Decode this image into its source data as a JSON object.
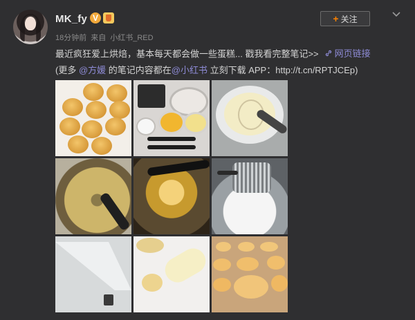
{
  "post": {
    "username": "MK_fy",
    "verified_badge": "V",
    "meta_time": "18分钟前",
    "meta_from": "来自",
    "meta_source": "小红书_RED",
    "follow_label": "关注",
    "line1_text": "最近疯狂爱上烘焙，基本每天都会做一些蛋糕... 戳我看完整笔记>>",
    "weblink_label": "网页链接",
    "line2_prefix": "(更多 ",
    "mention_user": "@方媛",
    "line2_mid": " 的笔记内容都在",
    "mention_app": "@小红书",
    "line2_suffix": " 立刻下载 APP：http://t.cn/RPTJCEp)"
  },
  "colors": {
    "background": "#2f2f31",
    "link": "#8e8bd6",
    "follow_plus": "#ff8200",
    "badge_v": "#f2a93b"
  },
  "icons": {
    "verified": "verified-v-icon",
    "level": "level-badge-icon",
    "follow": "plus-icon",
    "menu": "chevron-down-icon",
    "weblink": "link-icon"
  },
  "images": [
    {
      "name": "photo-baked-cookies"
    },
    {
      "name": "photo-ingredients"
    },
    {
      "name": "photo-whisk-bowl"
    },
    {
      "name": "photo-butter-mixing"
    },
    {
      "name": "photo-egg-yolk-mixing"
    },
    {
      "name": "photo-sifting-flour"
    },
    {
      "name": "photo-piping-bag"
    },
    {
      "name": "photo-piping-dough"
    },
    {
      "name": "photo-tray-cookies"
    }
  ]
}
